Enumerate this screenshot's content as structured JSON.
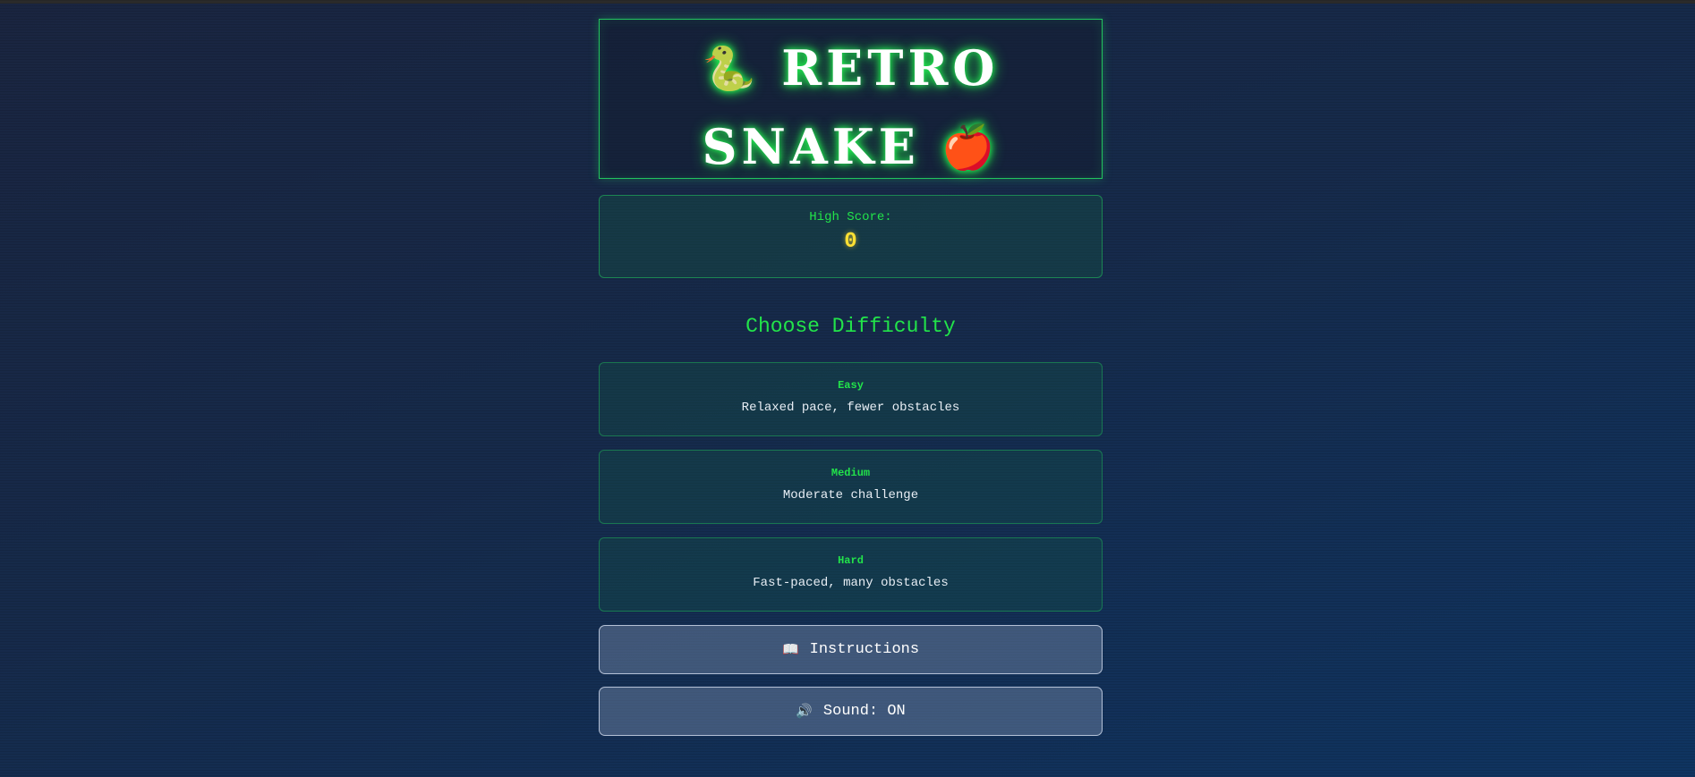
{
  "title": {
    "line1_icon": "🐍",
    "line1_text": "RETRO",
    "line2_text": "SNAKE",
    "line2_icon": "🍎"
  },
  "score": {
    "label": "High Score:",
    "value": "0"
  },
  "difficulty": {
    "heading": "Choose Difficulty",
    "options": [
      {
        "name": "Easy",
        "description": "Relaxed pace, fewer obstacles"
      },
      {
        "name": "Medium",
        "description": "Moderate challenge"
      },
      {
        "name": "Hard",
        "description": "Fast-paced, many obstacles"
      }
    ]
  },
  "buttons": {
    "instructions_icon": "📖",
    "instructions_label": "Instructions",
    "sound_icon": "🔊",
    "sound_label": "Sound: ON"
  },
  "colors": {
    "accent_green": "#22e34a",
    "score_yellow": "#ffe033",
    "background": "#162a4a"
  }
}
